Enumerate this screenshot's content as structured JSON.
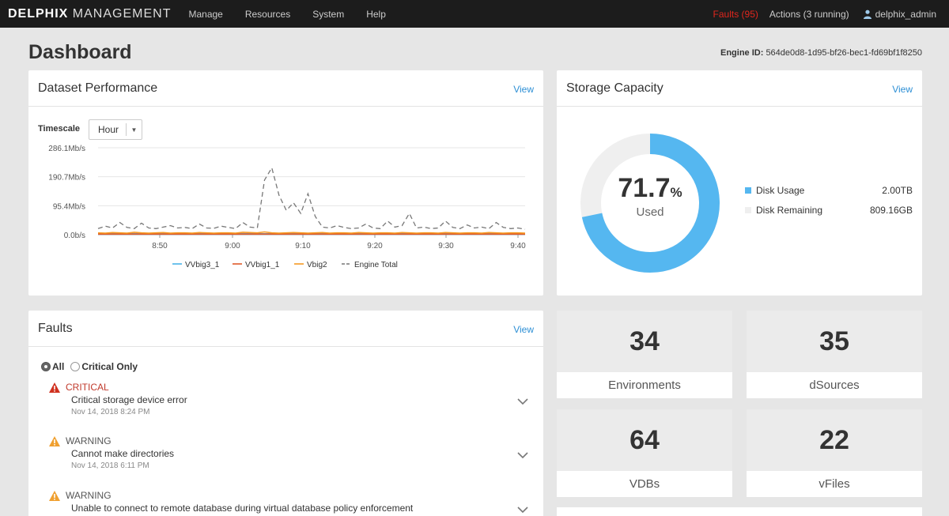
{
  "topbar": {
    "brand_bold": "DELPHIX",
    "brand_rest": "MANAGEMENT",
    "nav": [
      "Manage",
      "Resources",
      "System",
      "Help"
    ],
    "faults_link": "Faults (95)",
    "actions_link": "Actions (3 running)",
    "user": "delphix_admin",
    "faults_color": "#e0261d"
  },
  "header": {
    "title": "Dashboard",
    "engine_label": "Engine ID:",
    "engine_id": "564de0d8-1d95-bf26-bec1-fd69bf1f8250"
  },
  "perf": {
    "title": "Dataset Performance",
    "view": "View",
    "timescale_label": "Timescale",
    "timescale_value": "Hour",
    "chart_data": {
      "type": "line",
      "x_ticks": [
        "8:50",
        "9:00",
        "9:10",
        "9:20",
        "9:30",
        "9:40"
      ],
      "y_ticks": [
        "286.1Mb/s",
        "190.7Mb/s",
        "95.4Mb/s",
        "0.0b/s"
      ],
      "ylim": [
        0,
        286.1
      ],
      "grid": true,
      "legend_position": "bottom",
      "series": [
        {
          "name": "VVbig3_1",
          "color": "#4ab3e8",
          "dash": false,
          "values": [
            3,
            3,
            3,
            4,
            3,
            3,
            3,
            3,
            3,
            3,
            3,
            4,
            3,
            3,
            3,
            3,
            3,
            3,
            3,
            3,
            3,
            3,
            3,
            3,
            3,
            4,
            3,
            3,
            3,
            3,
            3,
            3,
            3,
            3,
            3,
            3,
            3,
            3,
            3,
            3,
            3,
            3,
            3,
            3,
            3,
            3,
            3,
            3,
            3,
            3,
            3,
            3,
            3,
            3,
            3,
            3,
            3,
            3,
            3,
            3
          ]
        },
        {
          "name": "VVbig1_1",
          "color": "#e05a2b",
          "dash": false,
          "values": [
            2,
            2,
            2,
            2,
            2,
            2,
            2,
            2,
            2,
            2,
            2,
            2,
            2,
            2,
            2,
            2,
            2,
            2,
            2,
            2,
            2,
            2,
            2,
            2,
            2,
            2,
            2,
            2,
            2,
            2,
            2,
            2,
            2,
            2,
            2,
            2,
            2,
            2,
            2,
            2,
            2,
            2,
            2,
            2,
            2,
            2,
            2,
            2,
            2,
            2,
            2,
            2,
            2,
            2,
            2,
            2,
            2,
            2,
            2,
            2
          ]
        },
        {
          "name": "Vbig2",
          "color": "#f59a23",
          "dash": false,
          "values": [
            6,
            5,
            7,
            6,
            5,
            8,
            6,
            5,
            6,
            7,
            5,
            6,
            6,
            5,
            7,
            6,
            5,
            6,
            6,
            5,
            8,
            7,
            6,
            9,
            6,
            5,
            6,
            7,
            6,
            5,
            6,
            7,
            5,
            6,
            6,
            5,
            7,
            6,
            5,
            6,
            6,
            5,
            7,
            6,
            5,
            6,
            6,
            5,
            7,
            6,
            5,
            6,
            6,
            5,
            7,
            6,
            5,
            6,
            6,
            5
          ]
        },
        {
          "name": "Engine Total",
          "color": "#777777",
          "dash": true,
          "values": [
            20,
            28,
            22,
            40,
            24,
            20,
            38,
            22,
            20,
            25,
            30,
            22,
            24,
            20,
            35,
            22,
            21,
            28,
            24,
            20,
            40,
            25,
            22,
            180,
            220,
            130,
            80,
            105,
            70,
            135,
            60,
            25,
            22,
            30,
            24,
            20,
            22,
            35,
            22,
            20,
            45,
            25,
            30,
            70,
            22,
            25,
            20,
            22,
            45,
            24,
            20,
            32,
            22,
            25,
            20,
            40,
            24,
            20,
            22,
            18
          ]
        }
      ]
    }
  },
  "storage": {
    "title": "Storage Capacity",
    "view": "View",
    "percent": "71.7",
    "percent_sign": "%",
    "used_label": "Used",
    "used_fraction": 0.717,
    "used_color": "#55b7f0",
    "remaining_color": "#efefef",
    "legend": [
      {
        "label": "Disk Usage",
        "value": "2.00TB",
        "color": "#55b7f0"
      },
      {
        "label": "Disk Remaining",
        "value": "809.16GB",
        "color": "#efefef"
      }
    ]
  },
  "faults": {
    "title": "Faults",
    "view": "View",
    "filter_all": "All",
    "filter_critical": "Critical Only",
    "items": [
      {
        "severity": "CRITICAL",
        "message": "Critical storage device error",
        "time": "Nov 14, 2018 8:24 PM"
      },
      {
        "severity": "WARNING",
        "message": "Cannot make directories",
        "time": "Nov 14, 2018 6:11 PM"
      },
      {
        "severity": "WARNING",
        "message": "Unable to connect to remote database during virtual database policy enforcement",
        "time": ""
      }
    ]
  },
  "stats": [
    {
      "value": "34",
      "label": "Environments"
    },
    {
      "value": "35",
      "label": "dSources"
    },
    {
      "value": "64",
      "label": "VDBs"
    },
    {
      "value": "22",
      "label": "vFiles"
    }
  ]
}
